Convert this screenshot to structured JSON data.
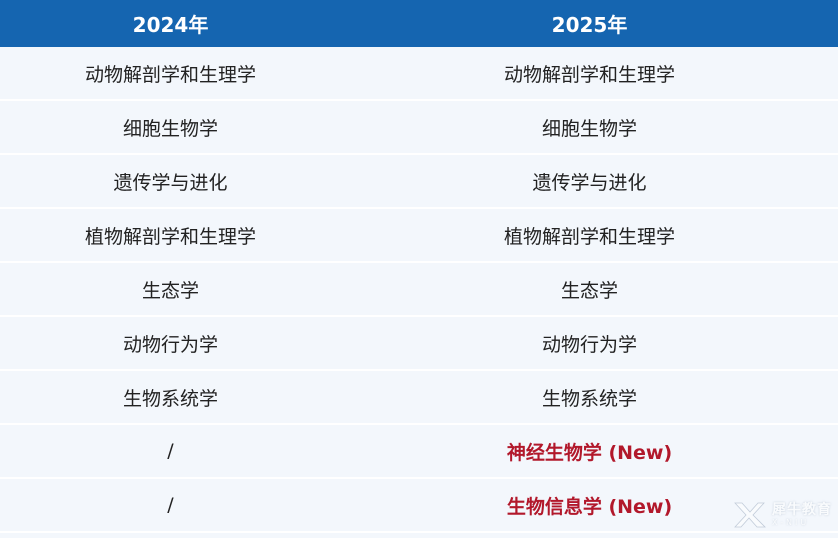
{
  "header": {
    "col1": "2024年",
    "col2": "2025年"
  },
  "rows": [
    {
      "y2024": "动物解剖学和生理学",
      "y2025": "动物解剖学和生理学"
    },
    {
      "y2024": "细胞生物学",
      "y2025": "细胞生物学"
    },
    {
      "y2024": "遗传学与进化",
      "y2025": "遗传学与进化"
    },
    {
      "y2024": "植物解剖学和生理学",
      "y2025": "植物解剖学和生理学"
    },
    {
      "y2024": "生态学",
      "y2025": "生态学"
    },
    {
      "y2024": "动物行为学",
      "y2025": "动物行为学"
    },
    {
      "y2024": "生物系统学",
      "y2025": "生物系统学"
    },
    {
      "y2024": "/",
      "y2025": "神经生物学 (New)"
    },
    {
      "y2024": "/",
      "y2025": "生物信息学 (New)"
    }
  ],
  "watermark": {
    "text_cn": "犀牛教育",
    "text_en": "X-NIU"
  },
  "colors": {
    "header_bg": "#1565b0",
    "row_bg": "#f3f7fc",
    "new_highlight": "#b2182b"
  }
}
